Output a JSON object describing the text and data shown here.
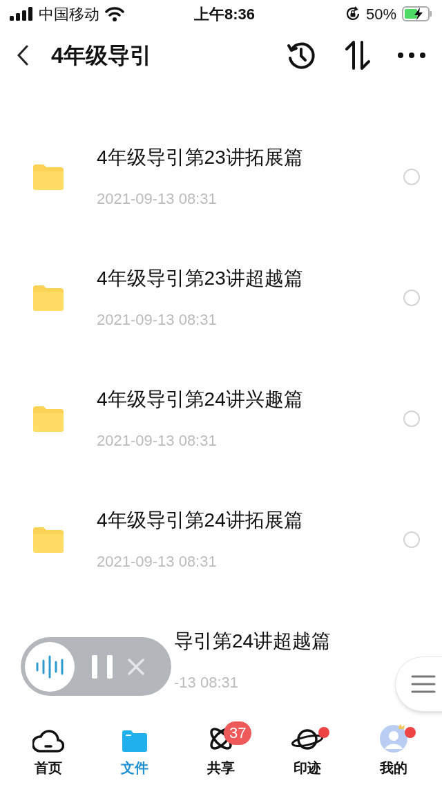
{
  "status_bar": {
    "carrier": "中国移动",
    "time": "上午8:36",
    "battery": "50%"
  },
  "header": {
    "title": "4年级导引"
  },
  "files": [
    {
      "title": "4年级导引第23讲拓展篇",
      "date": "2021-09-13 08:31",
      "selected": false,
      "covered": false
    },
    {
      "title": "4年级导引第23讲超越篇",
      "date": "2021-09-13 08:31",
      "selected": false,
      "covered": false
    },
    {
      "title": "4年级导引第24讲兴趣篇",
      "date": "2021-09-13 08:31",
      "selected": false,
      "covered": false
    },
    {
      "title": "4年级导引第24讲拓展篇",
      "date": "2021-09-13 08:31",
      "selected": false,
      "covered": false
    },
    {
      "title": "导引第24讲超越篇",
      "date": "-13 08:31",
      "covered": true
    }
  ],
  "tab_bar": [
    {
      "kind": "home",
      "label": "首页",
      "selected": false
    },
    {
      "kind": "files",
      "label": "文件",
      "selected": true
    },
    {
      "kind": "share",
      "label": "共享",
      "selected": false,
      "badge": "37"
    },
    {
      "kind": "trace",
      "label": "印迹",
      "selected": false,
      "dot": true
    },
    {
      "kind": "me",
      "label": "我的",
      "selected": false,
      "dot": true
    }
  ]
}
